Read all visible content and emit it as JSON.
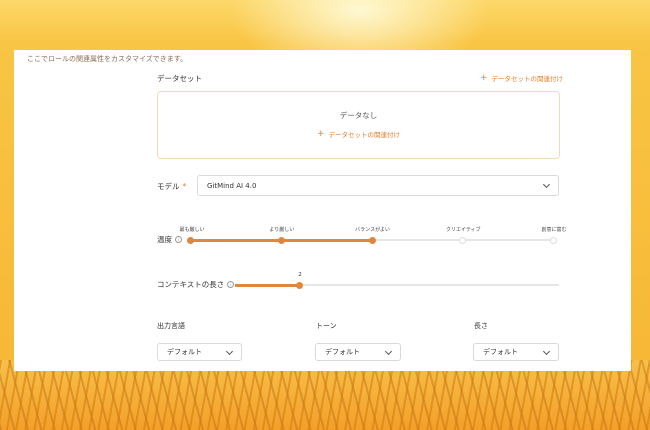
{
  "description": "ここでロールの関連属性をカスタマイズできます。",
  "dataset": {
    "title": "データセット",
    "link_label": "データセットの関連付け",
    "empty_text": "データなし",
    "inner_link_label": "データセットの関連付け"
  },
  "model": {
    "label": "モデル",
    "required_mark": "*",
    "value": "GitMind AI 4.0"
  },
  "temperature": {
    "label": "温度",
    "info": "i",
    "ticks": [
      "最も厳しい",
      "より厳しい",
      "バランスがよい",
      "クリエイティブ",
      "創意に富む"
    ],
    "selected_index": 2
  },
  "context": {
    "label": "コンテキストの長さ",
    "info": "i",
    "value": "2"
  },
  "output_language": {
    "label": "出力言語",
    "value": "デフォルト"
  },
  "tone": {
    "label": "トーン",
    "value": "デフォルト"
  },
  "length": {
    "label": "長さ",
    "value": "デフォルト"
  },
  "colors": {
    "accent": "#e0873f",
    "link": "#e67f2b"
  }
}
